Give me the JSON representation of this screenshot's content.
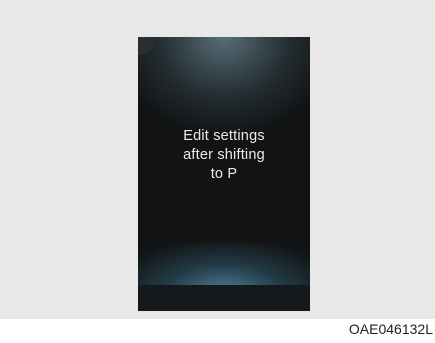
{
  "display": {
    "message_lines": [
      "Edit settings",
      "after shifting",
      "to P"
    ]
  },
  "figure_code": "OAE046132L",
  "colors": {
    "background_panel": "#e8e8e8",
    "screen": "#111314",
    "glow": "#5a96b4",
    "text": "#eaeaea"
  }
}
